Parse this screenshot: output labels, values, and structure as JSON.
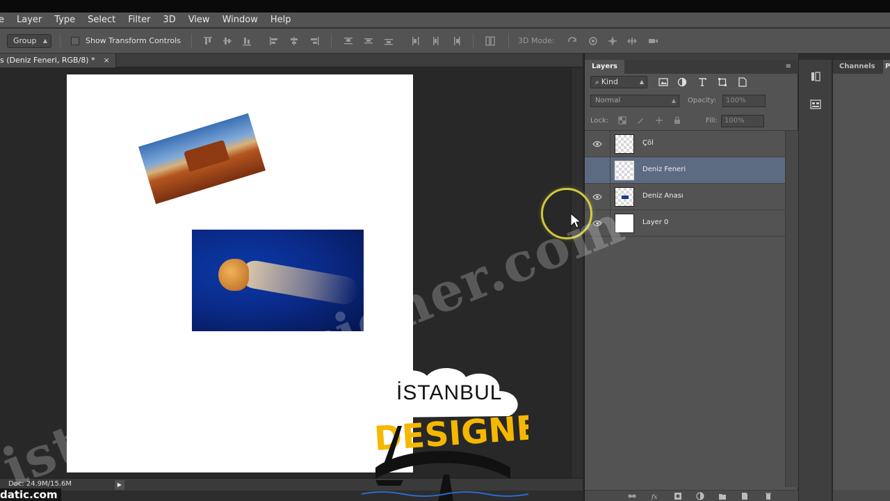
{
  "menu": [
    "e",
    "Layer",
    "Type",
    "Select",
    "Filter",
    "3D",
    "View",
    "Window",
    "Help"
  ],
  "options_bar": {
    "autoselect_value": "Group",
    "show_transform_label": "Show Transform Controls",
    "mode_3d_label": "3D Mode:"
  },
  "document": {
    "tab_title": "s (Deniz Feneri, RGB/8) *",
    "close_glyph": "×",
    "status_doc": "Doc: 24.9M/15.6M",
    "status_arrow": "▶"
  },
  "layers_panel": {
    "tab_label": "Layers",
    "menu_glyph": "≡",
    "filter_kind": "Kind",
    "blend_mode": "Normal",
    "opacity_label": "Opacity:",
    "opacity_value": "100%",
    "lock_label": "Lock:",
    "fill_label": "Fill:",
    "fill_value": "100%",
    "layers": [
      {
        "name": "Çöl",
        "visible": true,
        "selected": false,
        "thumb": "transparent"
      },
      {
        "name": "Deniz Feneri",
        "visible": false,
        "selected": true,
        "thumb": "transparent"
      },
      {
        "name": "Deniz Anası",
        "visible": true,
        "selected": false,
        "thumb": "jellyfish"
      },
      {
        "name": "Layer 0",
        "visible": true,
        "selected": false,
        "thumb": "white"
      }
    ]
  },
  "right_panel": {
    "tab_label": "Channels",
    "tab2_label": "P"
  },
  "overlay": {
    "watermark_text": "istanbuldesigner.com",
    "site_label": "datic.com",
    "logo_line1": "İSTANBUL",
    "logo_line2": "DESIGNER"
  },
  "colors": {
    "accent_selection": "#5d6b82",
    "cursor_ring": "#e2da40",
    "logo_yellow": "#f5b800"
  }
}
